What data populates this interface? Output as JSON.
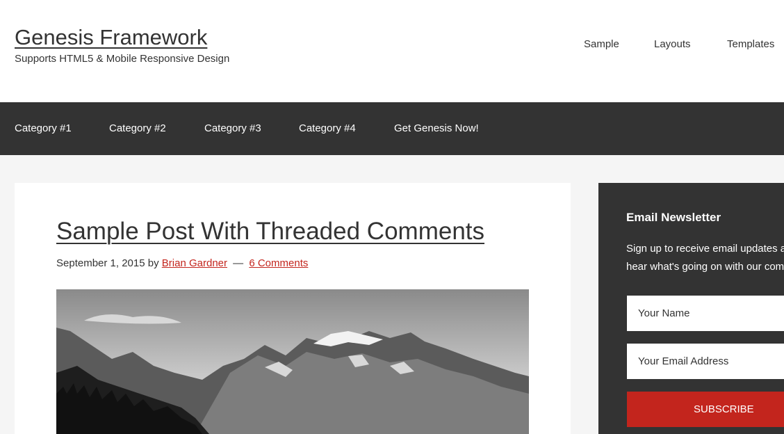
{
  "site": {
    "title": "Genesis Framework",
    "description": "Supports HTML5 & Mobile Responsive Design"
  },
  "header_nav": [
    "Sample",
    "Layouts",
    "Templates"
  ],
  "primary_nav": [
    "Category #1",
    "Category #2",
    "Category #3",
    "Category #4",
    "Get Genesis Now!"
  ],
  "post": {
    "title": "Sample Post With Threaded Comments",
    "date": "September 1, 2015",
    "by": "by",
    "author": "Brian Gardner",
    "separator": "—",
    "comments": "6 Comments"
  },
  "sidebar": {
    "widget_title": "Email Newsletter",
    "text_line1": "Sign up to receive email updates and to",
    "text_line2": "hear what's going on with our company!",
    "name_placeholder": "Your Name",
    "email_placeholder": "Your Email Address",
    "subscribe_label": "SUBSCRIBE"
  },
  "colors": {
    "accent": "#c3251d",
    "nav_background": "#333333",
    "page_background": "#f5f5f5"
  }
}
